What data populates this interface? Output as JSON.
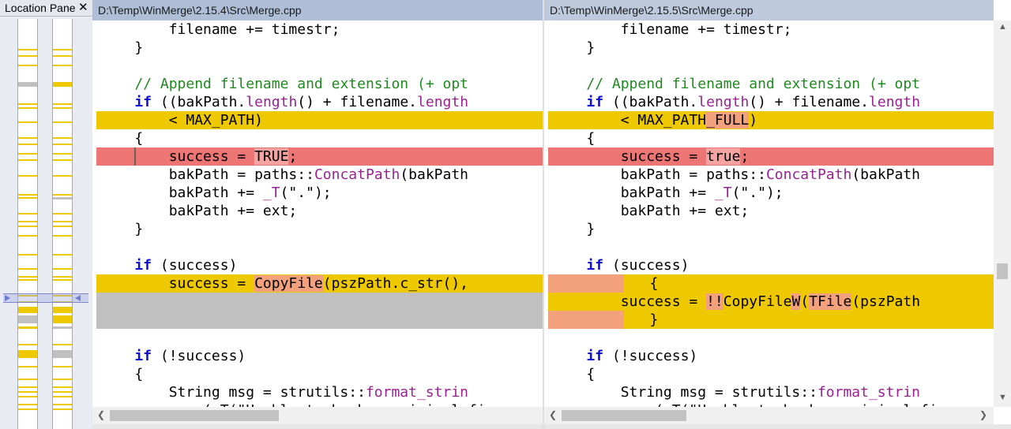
{
  "location_pane": {
    "title": "Location Pane",
    "close_glyph": "✕",
    "colors": {
      "changed": "#efc900",
      "moved": "#c0c0c0",
      "viewport": "#6f7bd0"
    }
  },
  "left_pane": {
    "path": "D:\\Temp\\WinMerge\\2.15.4\\Src\\Merge.cpp"
  },
  "right_pane": {
    "path": "D:\\Temp\\WinMerge\\2.15.5\\Src\\Merge.cpp"
  },
  "colors": {
    "diff_background": "#efc900",
    "selected_diff_background": "#ed7674",
    "missing_lines_background": "#c0c0c0",
    "inline_diff_highlight": "#f2a17c",
    "keyword": "#1010d0",
    "function": "#9b2193",
    "comment": "#1f8a1f"
  },
  "icons": {
    "scroll_left": "chevron-left-icon",
    "scroll_right": "chevron-right-icon",
    "scroll_up": "chevron-up-icon",
    "scroll_down": "chevron-down-icon"
  }
}
